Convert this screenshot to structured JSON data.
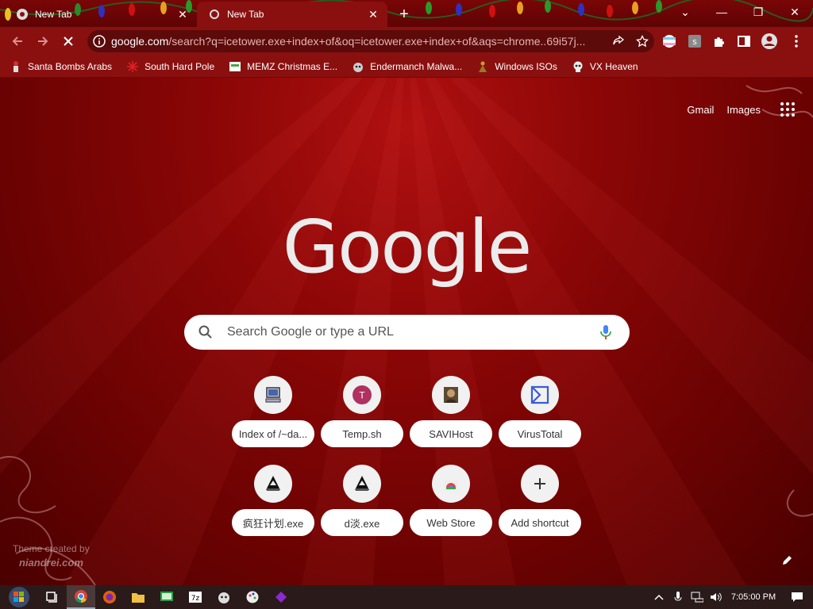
{
  "window": {
    "tabs": [
      {
        "title": "New Tab",
        "active": false
      },
      {
        "title": "New Tab",
        "active": true
      }
    ],
    "controls": {
      "tab_search": "⌄",
      "minimize": "—",
      "restore": "❐",
      "close": "✕"
    }
  },
  "address_bar": {
    "url_domain": "google.com",
    "url_path": "/search?q=icetower.exe+index+of&oq=icetower.exe+index+of&aqs=chrome..69i57j..."
  },
  "bookmarks": [
    {
      "label": "Santa Bombs Arabs",
      "icon": "santa-icon"
    },
    {
      "label": "South Hard Pole",
      "icon": "snowflake-icon"
    },
    {
      "label": "MEMZ Christmas E...",
      "icon": "page-icon"
    },
    {
      "label": "Endermanch Malwa...",
      "icon": "cat-icon"
    },
    {
      "label": "Windows ISOs",
      "icon": "figure-icon"
    },
    {
      "label": "VX Heaven",
      "icon": "skull-icon"
    }
  ],
  "ntp": {
    "gmail_label": "Gmail",
    "images_label": "Images",
    "logo_text": "Google",
    "search_placeholder": "Search Google or type a URL",
    "shortcuts": [
      {
        "label": "Index of /~da...",
        "icon": "computer-icon"
      },
      {
        "label": "Temp.sh",
        "icon": "letter-t-icon",
        "letter": "T"
      },
      {
        "label": "SAVIHost",
        "icon": "photo-icon"
      },
      {
        "label": "VirusTotal",
        "icon": "sigma-icon"
      },
      {
        "label": "疯狂计划.exe",
        "icon": "exe-icon"
      },
      {
        "label": "d淡.exe",
        "icon": "exe-icon"
      },
      {
        "label": "Web Store",
        "icon": "webstore-icon"
      },
      {
        "label": "Add shortcut",
        "icon": "plus-icon"
      }
    ],
    "theme_credit_line1": "Theme created by",
    "theme_credit_line2": "niandrei.com"
  },
  "taskbar": {
    "clock": "7:05:00 PM"
  },
  "colors": {
    "tabstrip": "#6a0505",
    "toolbar": "#8a1010",
    "omnibox": "#5c0a0a",
    "accent_red": "#c0392b"
  }
}
